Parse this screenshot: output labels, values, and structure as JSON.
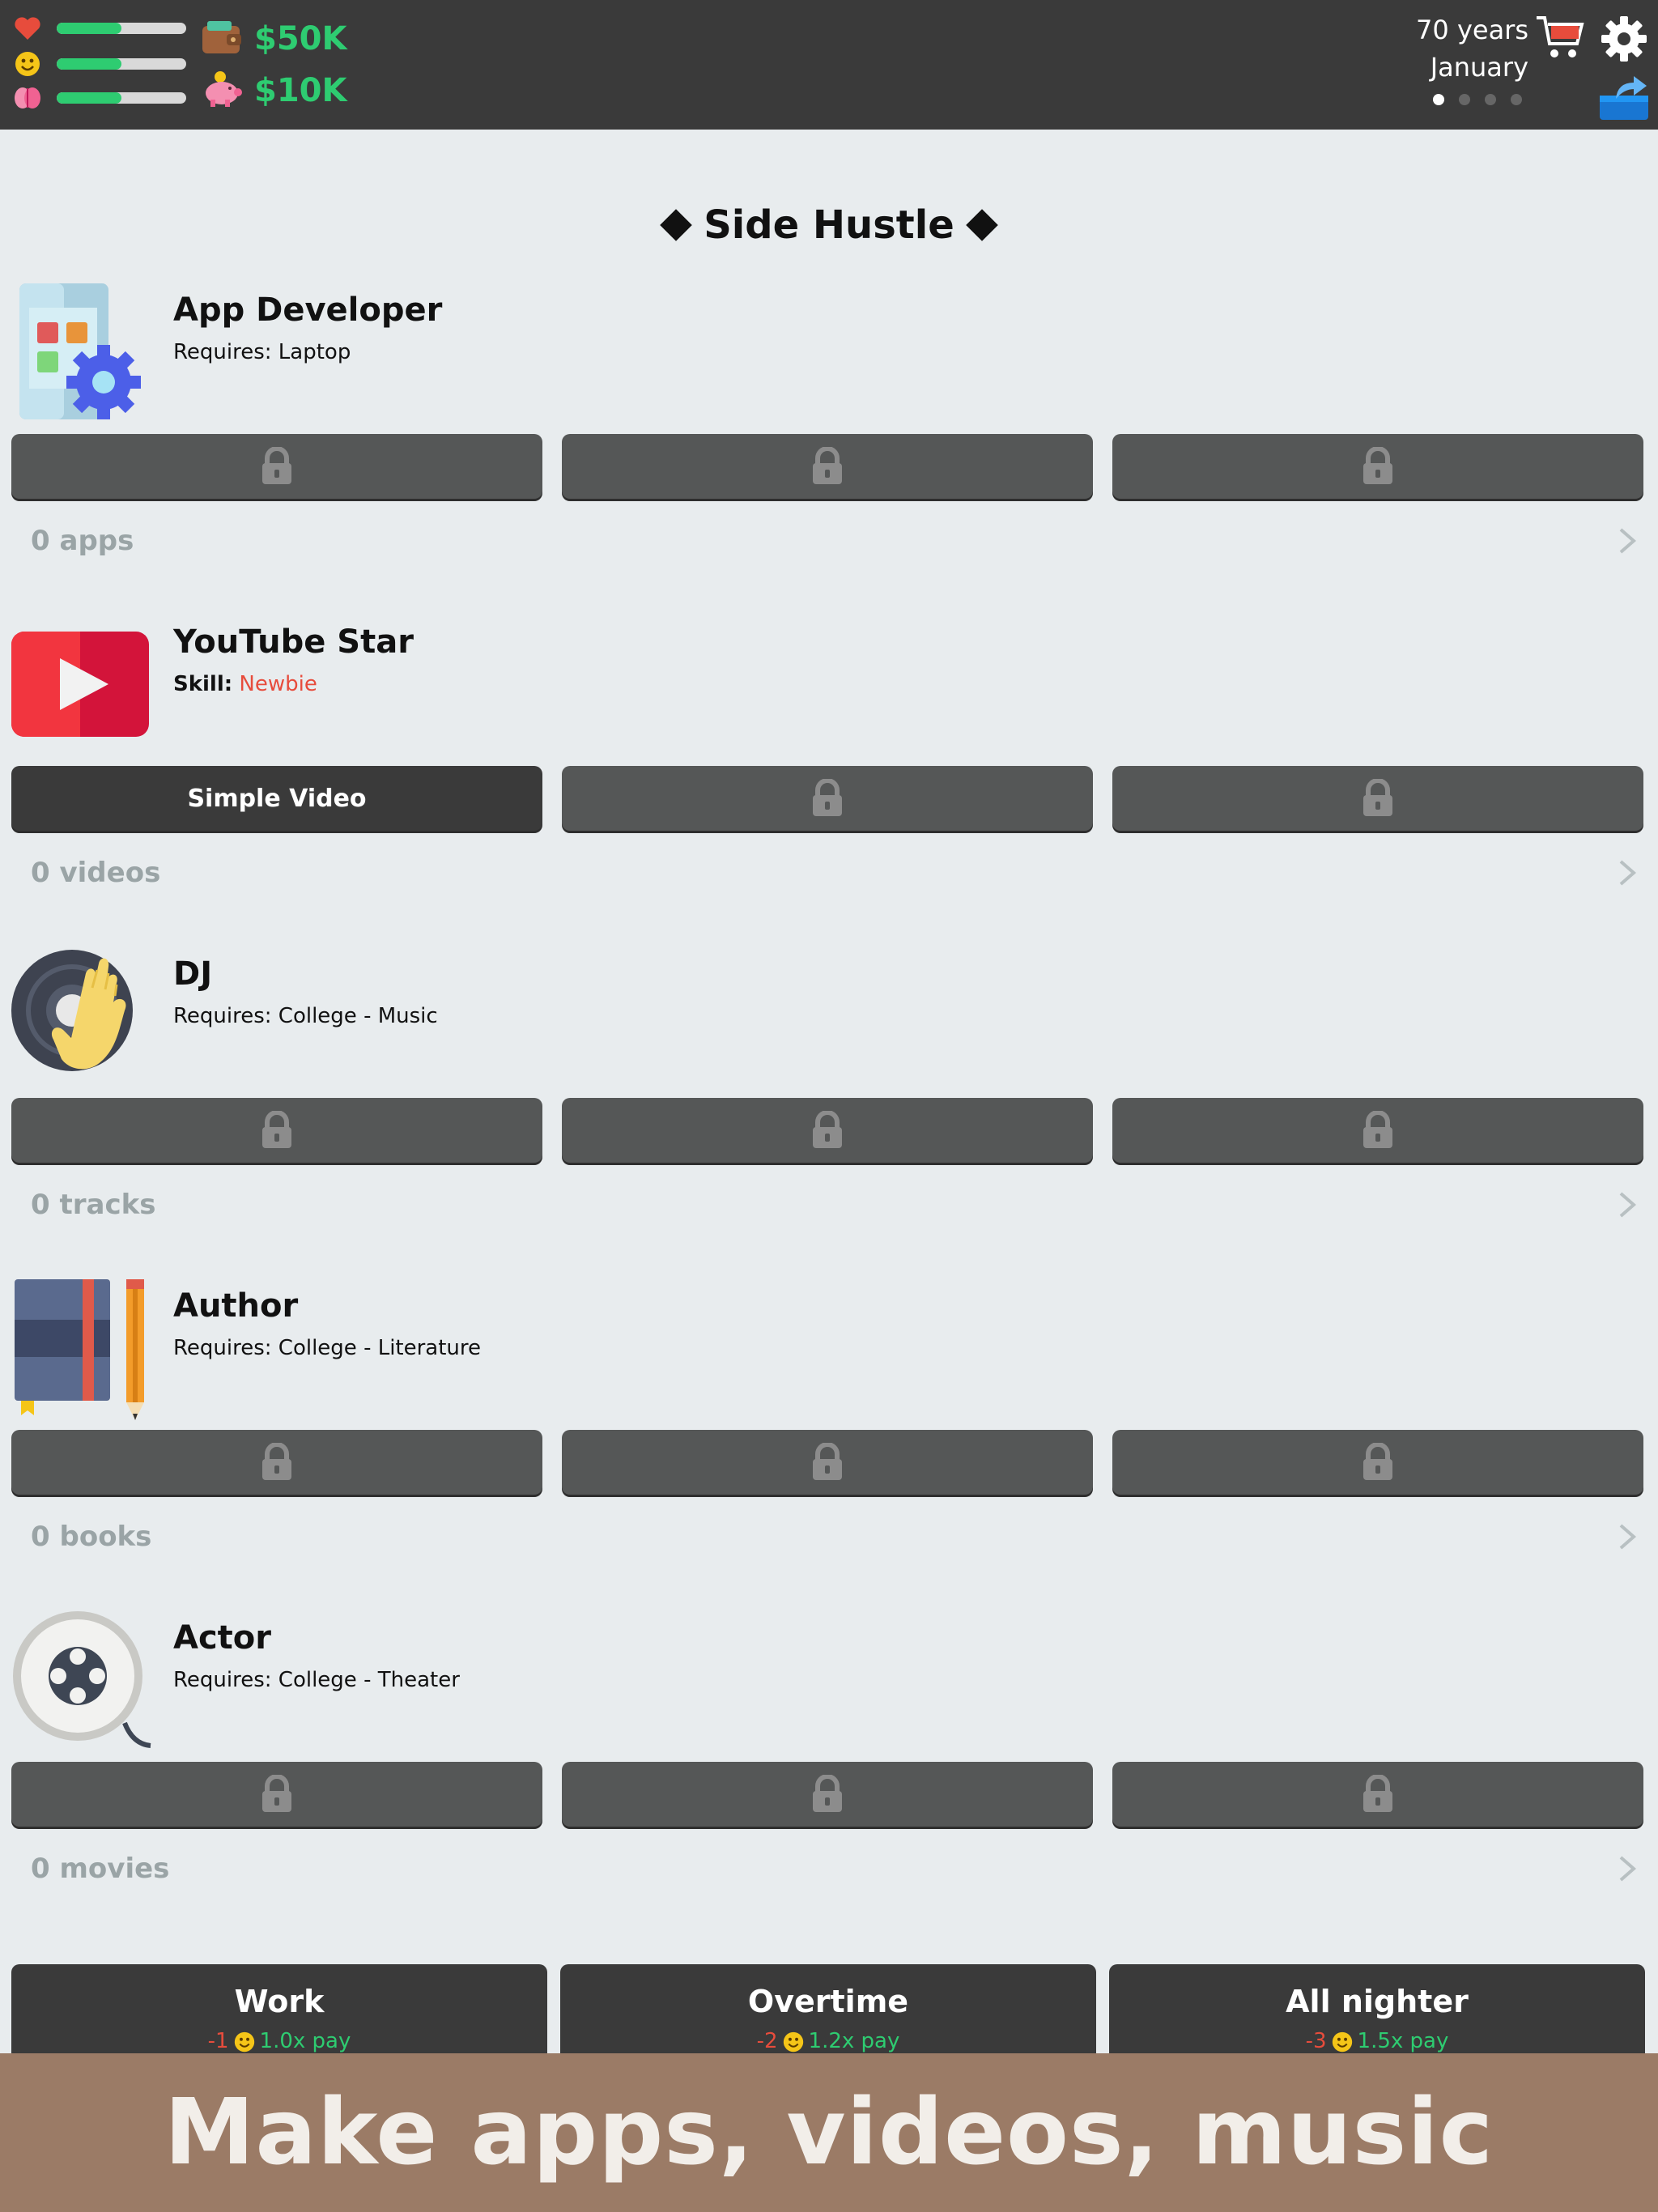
{
  "header": {
    "stats": [
      {
        "name": "health",
        "icon": "heart-icon",
        "level": 0.5
      },
      {
        "name": "happiness",
        "icon": "smiley-icon",
        "level": 0.5
      },
      {
        "name": "smarts",
        "icon": "brain-icon",
        "level": 0.5
      }
    ],
    "money": {
      "cash": "$50K",
      "savings": "$10K"
    },
    "age": "70 years",
    "month": "January",
    "page_dots": {
      "count": 4,
      "active": 1
    },
    "icons": [
      "wallet-icon",
      "piggy-bank-icon",
      "shopping-cart-icon",
      "gear-icon",
      "share-icon"
    ]
  },
  "title": "Side Hustle",
  "hustles": [
    {
      "name": "App Developer",
      "req_label": "Requires:",
      "req_value": "Laptop",
      "count": "0 apps",
      "icon": "app-dev-icon",
      "buttons": [
        "",
        "",
        ""
      ]
    },
    {
      "name": "YouTube Star",
      "req_label": "Skill:",
      "req_value": "Newbie",
      "count": "0 videos",
      "icon": "youtube-icon",
      "buttons": [
        "Simple Video",
        "",
        ""
      ]
    },
    {
      "name": "DJ",
      "req_label": "Requires:",
      "req_value": "College - Music",
      "count": "0 tracks",
      "icon": "dj-icon",
      "buttons": [
        "",
        "",
        ""
      ]
    },
    {
      "name": "Author",
      "req_label": "Requires:",
      "req_value": "College - Literature",
      "count": "0 books",
      "icon": "book-icon",
      "buttons": [
        "",
        "",
        ""
      ]
    },
    {
      "name": "Actor",
      "req_label": "Requires:",
      "req_value": "College - Theater",
      "count": "0 movies",
      "icon": "film-reel-icon",
      "buttons": [
        "",
        "",
        ""
      ]
    }
  ],
  "work": [
    {
      "title": "Work",
      "happiness": "-1",
      "pay": "1.0x pay"
    },
    {
      "title": "Overtime",
      "happiness": "-2",
      "pay": "1.2x pay"
    },
    {
      "title": "All nighter",
      "happiness": "-3",
      "pay": "1.5x pay"
    }
  ],
  "banner": "Make apps, videos, music",
  "colors": {
    "topbar": "#3a3a3a",
    "money": "#2ecc71",
    "banner": "#9b7b66",
    "button": "#555757",
    "negative": "#e74c3c"
  }
}
